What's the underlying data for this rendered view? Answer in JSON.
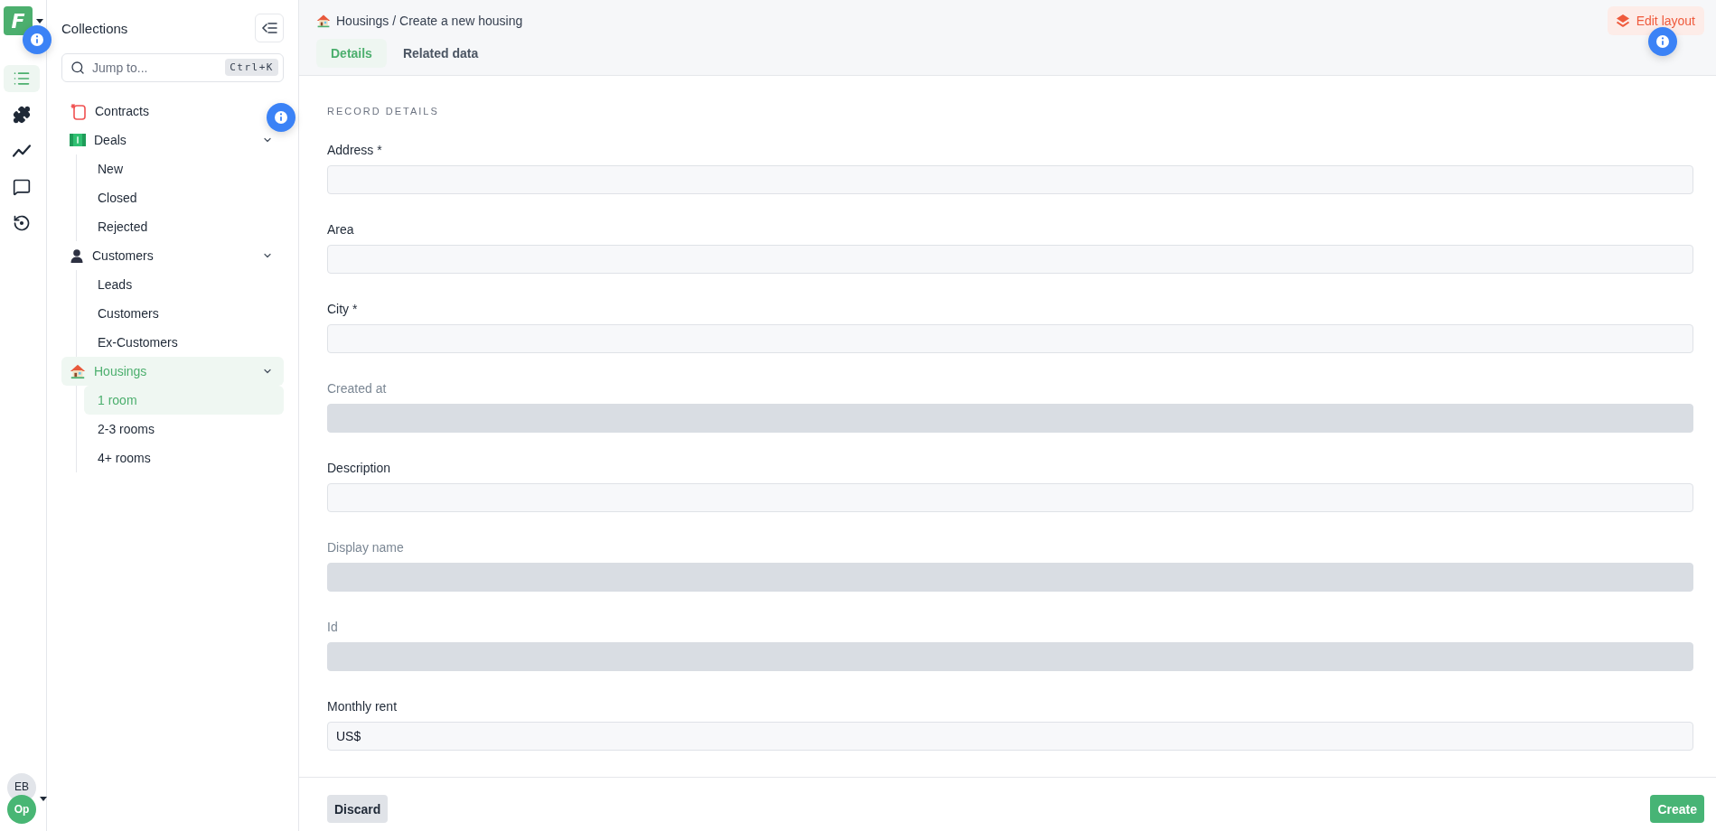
{
  "workspace": {
    "logo_letter": "F"
  },
  "rail": {
    "items": [
      {
        "kind": "collections",
        "selected": true
      },
      {
        "kind": "plugins",
        "selected": false
      },
      {
        "kind": "analytics",
        "selected": false
      },
      {
        "kind": "messages",
        "selected": false
      },
      {
        "kind": "history",
        "selected": false
      }
    ]
  },
  "account": {
    "user_initials": "EB",
    "org_initials": "Op"
  },
  "sidebar": {
    "title": "Collections",
    "search": {
      "placeholder": "Jump to...",
      "shortcut": "Ctrl+K"
    },
    "items": [
      {
        "label": "Contracts",
        "kind": "document",
        "selected": false
      },
      {
        "label": "Deals",
        "kind": "money",
        "selected": false,
        "expanded": true,
        "children": [
          {
            "label": "New",
            "selected": false
          },
          {
            "label": "Closed",
            "selected": false
          },
          {
            "label": "Rejected",
            "selected": false
          }
        ]
      },
      {
        "label": "Customers",
        "kind": "person",
        "selected": false,
        "expanded": true,
        "children": [
          {
            "label": "Leads",
            "selected": false
          },
          {
            "label": "Customers",
            "selected": false
          },
          {
            "label": "Ex-Customers",
            "selected": false
          }
        ]
      },
      {
        "label": "Housings",
        "kind": "house",
        "selected": true,
        "expanded": true,
        "children": [
          {
            "label": "1 room",
            "selected": true
          },
          {
            "label": "2-3 rooms",
            "selected": false
          },
          {
            "label": "4+ rooms",
            "selected": false
          }
        ]
      }
    ]
  },
  "header": {
    "breadcrumb": "Housings / Create a new housing",
    "tabs": [
      {
        "label": "Details",
        "selected": true
      },
      {
        "label": "Related data",
        "selected": false
      }
    ],
    "edit_layout_button": "Edit layout"
  },
  "form": {
    "section_title": "RECORD DETAILS",
    "fields": [
      {
        "label": "Address *",
        "disabled": false
      },
      {
        "label": "Area",
        "disabled": false
      },
      {
        "label": "City *",
        "disabled": false
      },
      {
        "label": "Created at",
        "disabled": true
      },
      {
        "label": "Description",
        "disabled": false
      },
      {
        "label": "Display name",
        "disabled": true
      },
      {
        "label": "Id",
        "disabled": true
      },
      {
        "label": "Monthly rent",
        "disabled": false,
        "prefix": "US$"
      }
    ]
  },
  "footer": {
    "discard_button": "Discard",
    "create_button": "Create"
  }
}
